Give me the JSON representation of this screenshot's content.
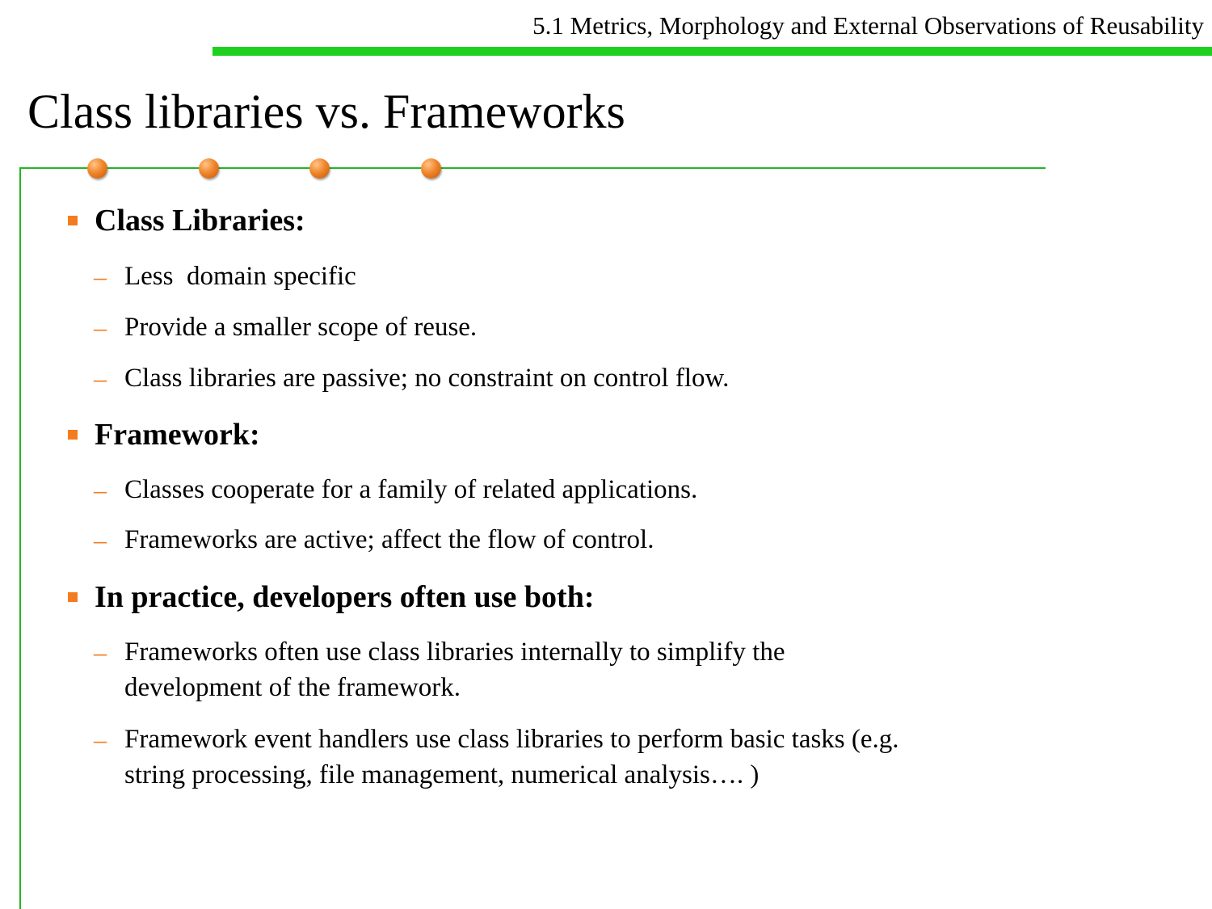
{
  "header": {
    "section": "5.1 Metrics, Morphology and External Observations of Reusability"
  },
  "title": "Class libraries vs. Frameworks",
  "bullets": [
    {
      "label": "Class Libraries:",
      "items": [
        [
          "Less  domain specific"
        ],
        [
          "Provide a smaller scope of reuse."
        ],
        [
          "Class libraries are passive; no constraint on control flow."
        ]
      ]
    },
    {
      "label": "Framework:",
      "items": [
        [
          "Classes cooperate for a family of related applications."
        ],
        [
          "Frameworks are active; affect the flow of control."
        ]
      ]
    },
    {
      "label": "In practice, developers often use both:",
      "items": [
        [
          "Frameworks often use class libraries internally to simplify the",
          "development of the framework."
        ],
        [
          "Framework event handlers use class libraries to perform basic tasks (e.g.",
          "string processing, file management, numerical analysis…. )"
        ]
      ]
    }
  ],
  "colors": {
    "header_rule": "#1fd01f",
    "frame_rule": "#22b522",
    "accent": "#f47c20",
    "text": "#000000"
  },
  "icons": {
    "bullet": "square-bullet",
    "sub_bullet": "en-dash",
    "decoration": "orange-dot"
  }
}
